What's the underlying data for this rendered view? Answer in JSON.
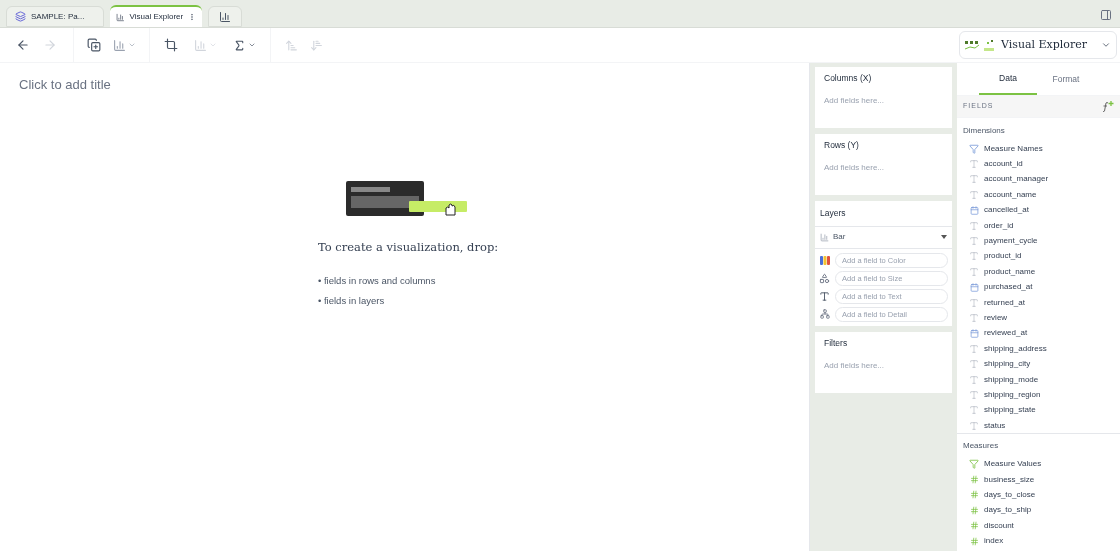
{
  "tabs": [
    {
      "label": "SAMPLE: Pa...",
      "kind": "dataset",
      "selected": false
    },
    {
      "label": "Visual Explorer",
      "kind": "explorer",
      "selected": true
    }
  ],
  "canvas": {
    "title_placeholder": "Click to add title",
    "heading": "To create a visualization, drop:",
    "bullets": [
      "• fields in rows and columns",
      "• fields in layers"
    ]
  },
  "viz_picker": {
    "label": "Visual Explorer"
  },
  "shelves": [
    {
      "title": "Columns (X)",
      "placeholder": "Add fields here..."
    },
    {
      "title": "Rows (Y)",
      "placeholder": "Add fields here..."
    }
  ],
  "layers": {
    "title": "Layers",
    "mark": "Bar",
    "encodings": [
      {
        "kind": "color",
        "placeholder": "Add a field to Color"
      },
      {
        "kind": "size",
        "placeholder": "Add a field to Size"
      },
      {
        "kind": "text",
        "placeholder": "Add a field to Text"
      },
      {
        "kind": "detail",
        "placeholder": "Add a field to Detail"
      }
    ]
  },
  "filters": {
    "title": "Filters",
    "placeholder": "Add fields here..."
  },
  "panel_tabs": [
    {
      "label": "Data",
      "selected": true
    },
    {
      "label": "Format",
      "selected": false
    }
  ],
  "fields_header": "FIELDS",
  "groups": [
    {
      "title": "Dimensions",
      "fields": [
        {
          "name": "Measure Names",
          "kind": "names"
        },
        {
          "name": "account_id",
          "kind": "text"
        },
        {
          "name": "account_manager",
          "kind": "text"
        },
        {
          "name": "account_name",
          "kind": "text"
        },
        {
          "name": "cancelled_at",
          "kind": "date"
        },
        {
          "name": "order_id",
          "kind": "text"
        },
        {
          "name": "payment_cycle",
          "kind": "text"
        },
        {
          "name": "product_id",
          "kind": "text"
        },
        {
          "name": "product_name",
          "kind": "text"
        },
        {
          "name": "purchased_at",
          "kind": "date"
        },
        {
          "name": "returned_at",
          "kind": "text"
        },
        {
          "name": "review",
          "kind": "text"
        },
        {
          "name": "reviewed_at",
          "kind": "date"
        },
        {
          "name": "shipping_address",
          "kind": "text"
        },
        {
          "name": "shipping_city",
          "kind": "text"
        },
        {
          "name": "shipping_mode",
          "kind": "text"
        },
        {
          "name": "shipping_region",
          "kind": "text"
        },
        {
          "name": "shipping_state",
          "kind": "text"
        },
        {
          "name": "status",
          "kind": "text"
        }
      ]
    },
    {
      "title": "Measures",
      "fields": [
        {
          "name": "Measure Values",
          "kind": "values"
        },
        {
          "name": "business_size",
          "kind": "number"
        },
        {
          "name": "days_to_close",
          "kind": "number"
        },
        {
          "name": "days_to_ship",
          "kind": "number"
        },
        {
          "name": "discount",
          "kind": "number"
        },
        {
          "name": "index",
          "kind": "number"
        }
      ]
    }
  ]
}
